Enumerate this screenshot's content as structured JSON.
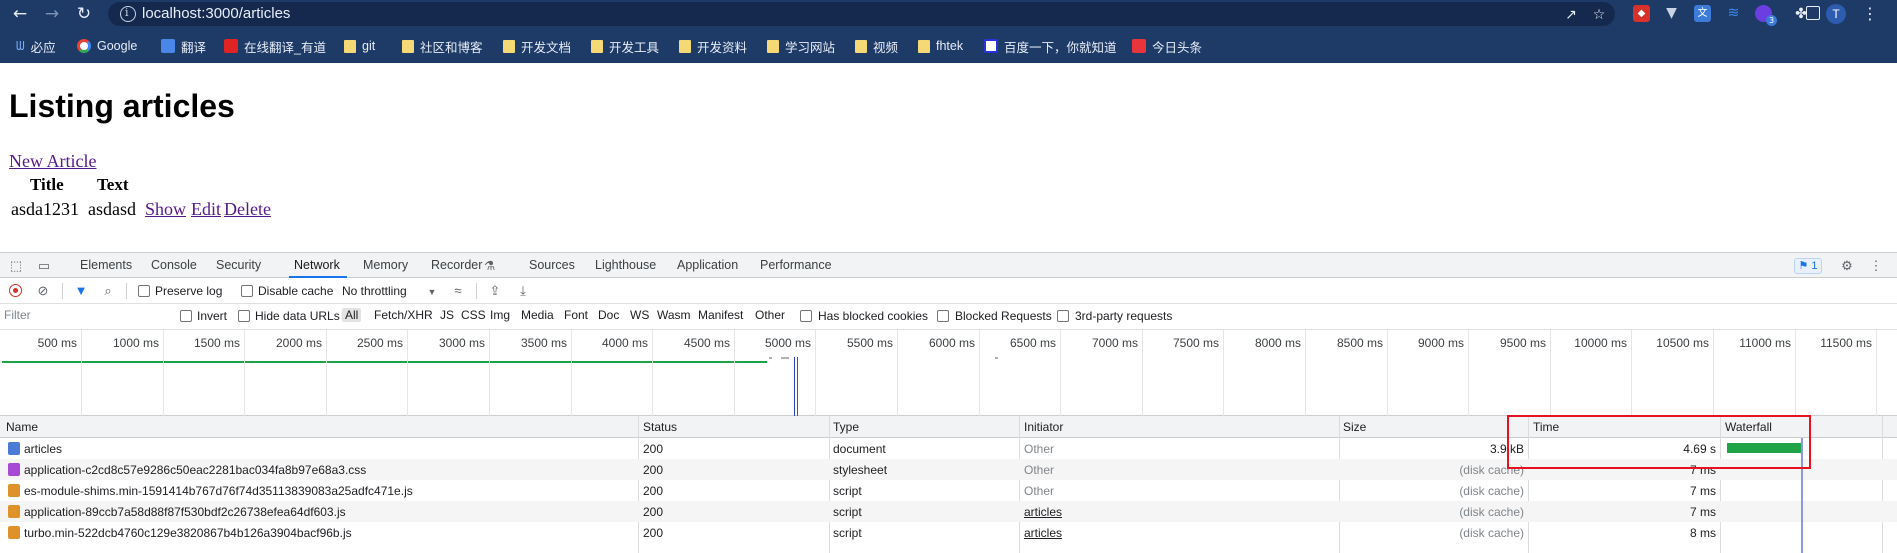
{
  "browser": {
    "url": "localhost:3000/articles",
    "bookmarks": [
      {
        "label": "必应",
        "icon": "bing-icon"
      },
      {
        "label": "Google",
        "icon": "google-icon"
      },
      {
        "label": "翻译",
        "icon": "translate-icon"
      },
      {
        "label": "在线翻译_有道",
        "icon": "youdao-icon"
      },
      {
        "label": "git",
        "icon": "folder-icon"
      },
      {
        "label": "社区和博客",
        "icon": "folder-icon"
      },
      {
        "label": "开发文档",
        "icon": "folder-icon"
      },
      {
        "label": "开发工具",
        "icon": "folder-icon"
      },
      {
        "label": "开发资料",
        "icon": "folder-icon"
      },
      {
        "label": "学习网站",
        "icon": "folder-icon"
      },
      {
        "label": "视频",
        "icon": "folder-icon"
      },
      {
        "label": "fhtek",
        "icon": "folder-icon"
      },
      {
        "label": "百度一下，你就知道",
        "icon": "baidu-icon"
      },
      {
        "label": "今日头条",
        "icon": "toutiao-icon"
      }
    ],
    "profile_initial": "T",
    "extension_badge": "3"
  },
  "page": {
    "title": "Listing articles",
    "new_link": "New Article",
    "headers": [
      "Title",
      "Text"
    ],
    "rows": [
      {
        "title": "asda1231",
        "text": "asdasd",
        "actions": [
          "Show",
          "Edit",
          "Delete"
        ]
      }
    ]
  },
  "devtools": {
    "tabs": [
      "Elements",
      "Console",
      "Security",
      "Network",
      "Memory",
      "Recorder",
      "Sources",
      "Lighthouse",
      "Application",
      "Performance"
    ],
    "active_tab": "Network",
    "issues_count": "1",
    "toolbar": {
      "preserve_log": "Preserve log",
      "disable_cache": "Disable cache",
      "throttling": "No throttling"
    },
    "filter": {
      "placeholder": "Filter",
      "invert": "Invert",
      "hide_data_urls": "Hide data URLs",
      "types": [
        "All",
        "Fetch/XHR",
        "JS",
        "CSS",
        "Img",
        "Media",
        "Font",
        "Doc",
        "WS",
        "Wasm",
        "Manifest",
        "Other"
      ],
      "has_blocked_cookies": "Has blocked cookies",
      "blocked_requests": "Blocked Requests",
      "third_party": "3rd-party requests"
    },
    "timeline_ticks": [
      "500 ms",
      "1000 ms",
      "1500 ms",
      "2000 ms",
      "2500 ms",
      "3000 ms",
      "3500 ms",
      "4000 ms",
      "4500 ms",
      "5000 ms",
      "5500 ms",
      "6000 ms",
      "6500 ms",
      "7000 ms",
      "7500 ms",
      "8000 ms",
      "8500 ms",
      "9000 ms",
      "9500 ms",
      "10000 ms",
      "10500 ms",
      "11000 ms",
      "11500 ms"
    ],
    "columns": [
      "Name",
      "Status",
      "Type",
      "Initiator",
      "Size",
      "Time",
      "Waterfall"
    ],
    "requests": [
      {
        "name": "articles",
        "status": "200",
        "type": "document",
        "initiator": "Other",
        "initiator_link": false,
        "size": "3.9 kB",
        "time": "4.69 s",
        "icon_color": "#4a7bd6",
        "waterfall_fraction": 0.98
      },
      {
        "name": "application-c2cd8c57e9286c50eac2281bac034fa8b97e68a3.css",
        "status": "200",
        "type": "stylesheet",
        "initiator": "Other",
        "initiator_link": false,
        "size": "(disk cache)",
        "time": "7 ms",
        "icon_color": "#a64ad6",
        "waterfall_fraction": 0.0
      },
      {
        "name": "es-module-shims.min-1591414b767d76f74d35113839083a25adfc471e.js",
        "status": "200",
        "type": "script",
        "initiator": "Other",
        "initiator_link": false,
        "size": "(disk cache)",
        "time": "7 ms",
        "icon_color": "#e0922a",
        "waterfall_fraction": 0.0
      },
      {
        "name": "application-89ccb7a58d88f87f530bdf2c26738efea64df603.js",
        "status": "200",
        "type": "script",
        "initiator": "articles",
        "initiator_link": true,
        "size": "(disk cache)",
        "time": "7 ms",
        "icon_color": "#e0922a",
        "waterfall_fraction": 0.0
      },
      {
        "name": "turbo.min-522dcb4760c129e3820867b4b126a3904bacf96b.js",
        "status": "200",
        "type": "script",
        "initiator": "articles",
        "initiator_link": true,
        "size": "(disk cache)",
        "time": "8 ms",
        "icon_color": "#e0922a",
        "waterfall_fraction": 0.0
      }
    ]
  }
}
